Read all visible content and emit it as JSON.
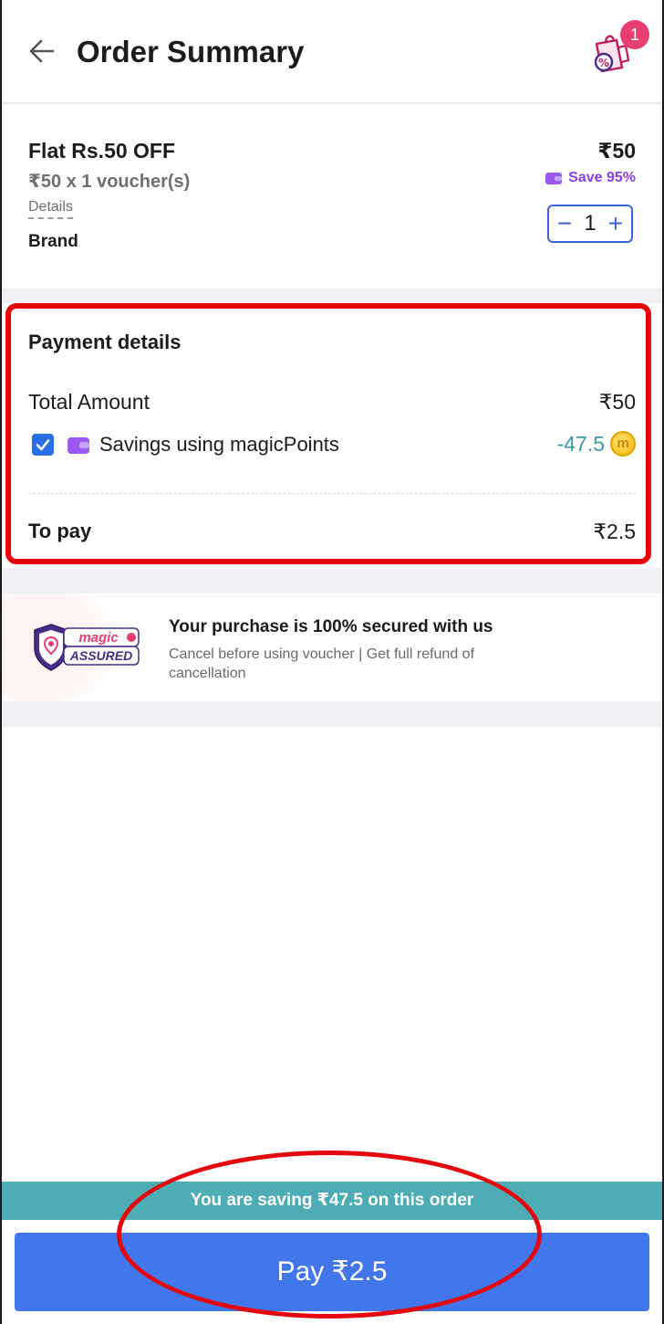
{
  "header": {
    "title": "Order Summary",
    "cart_count": "1"
  },
  "product": {
    "name": "Flat Rs.50 OFF",
    "quantity_text": "₹50 x 1 voucher(s)",
    "details_label": "Details",
    "brand": "Brand",
    "price": "₹50",
    "save_text": "Save 95%",
    "quantity": "1"
  },
  "payment": {
    "title": "Payment details",
    "total_label": "Total Amount",
    "total_value": "₹50",
    "points_label": "Savings using magicPoints",
    "points_value": "-47.5",
    "points_checked": true,
    "to_pay_label": "To pay",
    "to_pay_value": "₹2.5"
  },
  "security": {
    "logo_text_1": "magic",
    "logo_text_2": "ASSURED",
    "title": "Your purchase is 100% secured with us",
    "subtitle": "Cancel before using voucher | Get full refund of cancellation"
  },
  "footer": {
    "saving_text": "You are saving ₹47.5 on this order",
    "pay_button": "Pay ₹2.5"
  },
  "colors": {
    "accent_blue": "#4277eb",
    "teal": "#4eacb4",
    "purple": "#8a3ee6",
    "highlight_red": "#e5060d"
  }
}
